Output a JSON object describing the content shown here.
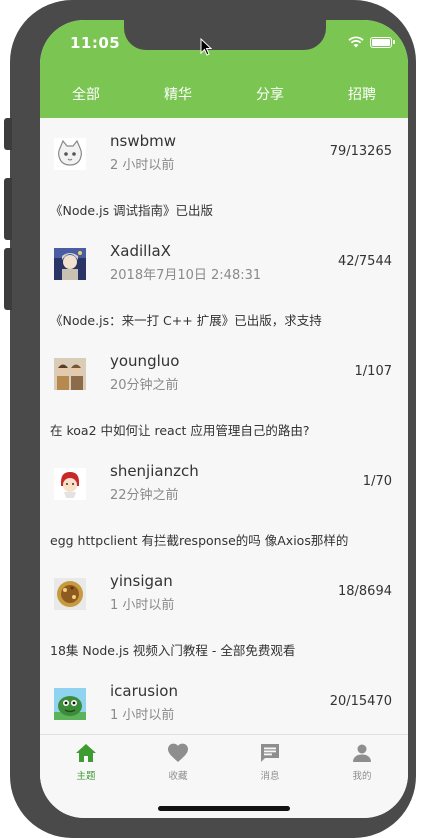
{
  "status": {
    "time": "11:05"
  },
  "tabs": [
    {
      "label": "全部",
      "active": true
    },
    {
      "label": "精华",
      "active": false
    },
    {
      "label": "分享",
      "active": false
    },
    {
      "label": "招聘",
      "active": false
    }
  ],
  "topics": [
    {
      "user": "nswbmw",
      "time": "2 小时以前",
      "count": "79/13265",
      "title": "《Node.js 调试指南》已出版",
      "avatar_icon": "cat-avatar-icon"
    },
    {
      "user": "XadillaX",
      "time": "2018年7月10日 2:48:31",
      "count": "42/7544",
      "title": "《Node.js：来一打 C++ 扩展》已出版，求支持",
      "avatar_icon": "anime-avatar-icon"
    },
    {
      "user": "youngluo",
      "time": "20分钟之前",
      "count": "1/107",
      "title": "在 koa2 中如何让 react 应用管理自己的路由?",
      "avatar_icon": "group-avatar-icon"
    },
    {
      "user": "shenjianzch",
      "time": "22分钟之前",
      "count": "1/70",
      "title": "egg httpclient 有拦截response的吗 像Axios那样的",
      "avatar_icon": "cartoon-avatar-icon"
    },
    {
      "user": "yinsigan",
      "time": "1 小时以前",
      "count": "18/8694",
      "title": "18集 Node.js 视频入门教程 - 全部免费观看",
      "avatar_icon": "food-avatar-icon"
    },
    {
      "user": "icarusion",
      "time": "1 小时以前",
      "count": "20/15470",
      "title": "",
      "avatar_icon": "monster-avatar-icon"
    }
  ],
  "bottom_nav": [
    {
      "label": "主题",
      "icon": "home-icon",
      "active": true
    },
    {
      "label": "收藏",
      "icon": "heart-icon",
      "active": false
    },
    {
      "label": "消息",
      "icon": "message-icon",
      "active": false
    },
    {
      "label": "我的",
      "icon": "person-icon",
      "active": false
    }
  ],
  "colors": {
    "header": "#7bc653",
    "active_nav": "#3d9b32",
    "inactive_nav": "#8e8e8e",
    "frame": "#4a4a4a"
  }
}
